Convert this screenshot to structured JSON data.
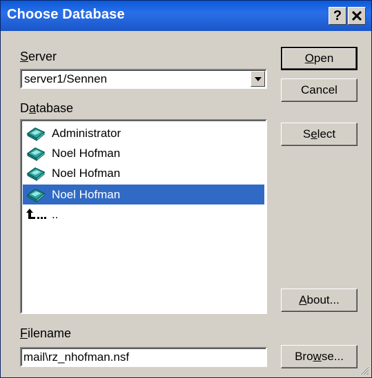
{
  "window": {
    "title": "Choose Database"
  },
  "titlebar_buttons": {
    "help": "?",
    "close_icon": "close-icon"
  },
  "server": {
    "label_accel": "S",
    "label_rest": "erver",
    "value": "server1/Sennen"
  },
  "database": {
    "label_pre": "D",
    "label_accel": "a",
    "label_rest": "tabase",
    "items": [
      {
        "label": "Administrator",
        "icon": "database-icon",
        "selected": false
      },
      {
        "label": "Noel Hofman",
        "icon": "database-icon",
        "selected": false
      },
      {
        "label": "Noel Hofman",
        "icon": "database-icon",
        "selected": false
      },
      {
        "label": "Noel Hofman",
        "icon": "database-icon",
        "selected": true
      },
      {
        "label": "..",
        "icon": "parent-folder-icon",
        "selected": false
      }
    ]
  },
  "filename": {
    "label_accel": "F",
    "label_rest": "ilename",
    "value": "mail\\rz_nhofman.nsf"
  },
  "buttons": {
    "open": {
      "accel": "O",
      "rest": "pen"
    },
    "cancel": {
      "label": "Cancel"
    },
    "select": {
      "pre": "S",
      "accel": "e",
      "rest": "lect"
    },
    "about": {
      "accel": "A",
      "rest": "bout..."
    },
    "browse": {
      "pre": "Bro",
      "accel": "w",
      "rest": "se..."
    }
  },
  "colors": {
    "selection": "#316ac5",
    "titlebar": "#0b5ad9",
    "face": "#d4d0c8"
  }
}
